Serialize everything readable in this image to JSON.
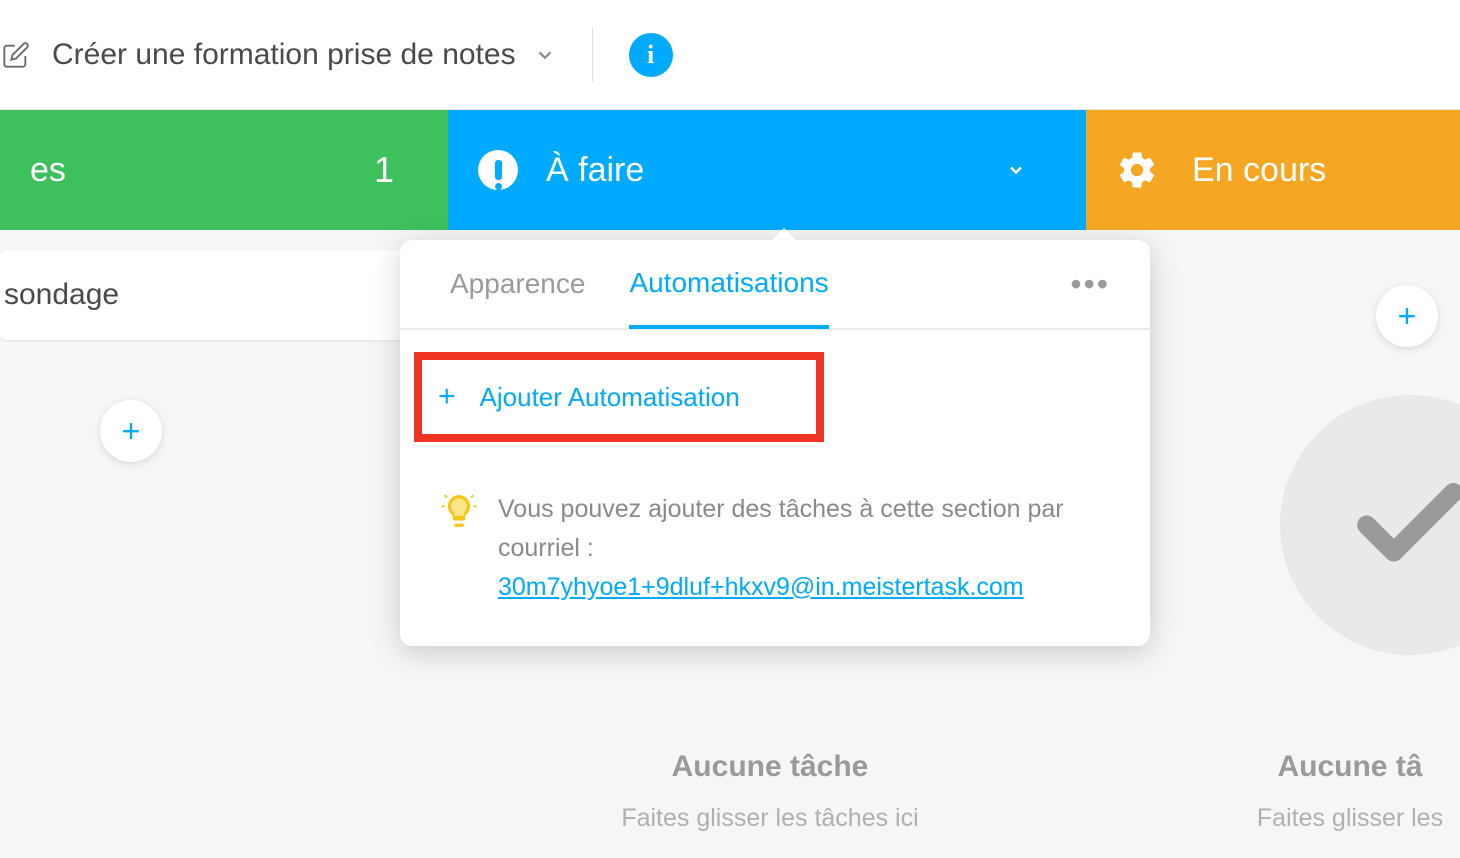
{
  "header": {
    "project_title": "Créer une formation prise de notes"
  },
  "columns": {
    "green": {
      "title_partial": "es",
      "count": "1"
    },
    "blue": {
      "title": "À faire"
    },
    "orange": {
      "title": "En cours"
    }
  },
  "card": {
    "sondage_partial": "sondage"
  },
  "dropdown": {
    "tab_appearance": "Apparence",
    "tab_automations": "Automatisations",
    "add_automation": "Ajouter Automatisation",
    "hint_text": "Vous pouvez ajouter des tâches à cette section par courriel :",
    "hint_email": "30m7yhyoe1+9dluf+hkxv9@in.meistertask.com"
  },
  "empty": {
    "title": "Aucune tâche",
    "subtitle_full": "Faites glisser les tâches ici",
    "title_partial": "Aucune tâ",
    "subtitle_partial": "Faites glisser les"
  }
}
